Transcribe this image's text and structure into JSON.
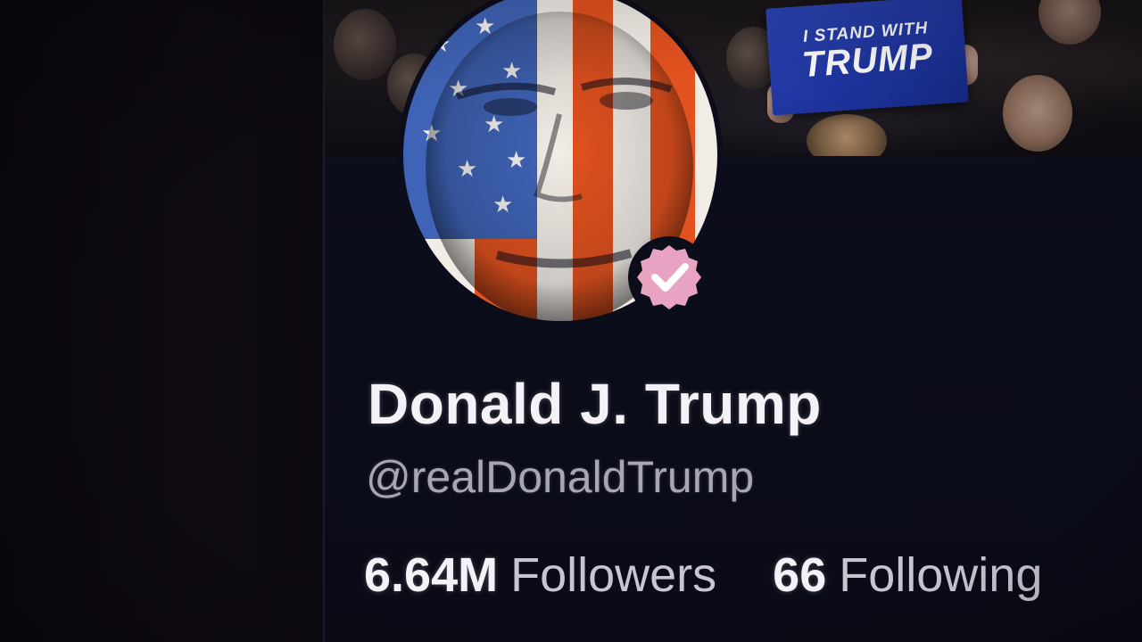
{
  "profile": {
    "display_name": "Donald J. Trump",
    "handle": "@realDonaldTrump",
    "verified": true,
    "verified_badge_icon": "verified-check-icon",
    "avatar_icon": "flag-portrait-avatar"
  },
  "banner": {
    "sign_line1": "I STAND WITH",
    "sign_line2": "TRUMP"
  },
  "stats": {
    "followers_count": "6.64M",
    "followers_label": "Followers",
    "following_count": "66",
    "following_label": "Following"
  },
  "colors": {
    "background": "#0b0c1a",
    "name_text": "#f4f2f6",
    "handle_text": "#a9a6b4",
    "badge_pink": "#e8a3c3",
    "sign_blue": "#1f35a0",
    "flag_red": "#e2521f",
    "flag_blue": "#3f63b6"
  }
}
